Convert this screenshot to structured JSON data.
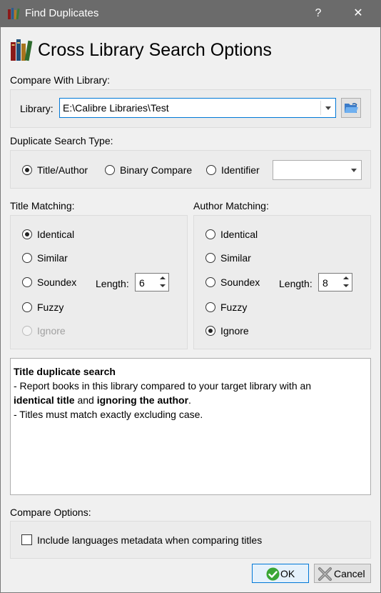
{
  "window": {
    "title": "Find Duplicates",
    "help_label": "?",
    "close_label": "✕"
  },
  "header": {
    "title": "Cross Library Search Options"
  },
  "compare_with": {
    "section_label": "Compare With Library:",
    "library_label": "Library:",
    "library_value": "E:\\Calibre Libraries\\Test"
  },
  "search_type": {
    "section_label": "Duplicate Search Type:",
    "options": [
      "Title/Author",
      "Binary Compare",
      "Identifier"
    ],
    "selected": "Title/Author",
    "identifier_value": ""
  },
  "title_matching": {
    "section_label": "Title Matching:",
    "options": [
      "Identical",
      "Similar",
      "Soundex",
      "Fuzzy",
      "Ignore"
    ],
    "selected": "Identical",
    "length_label": "Length:",
    "length_value": "6"
  },
  "author_matching": {
    "section_label": "Author Matching:",
    "options": [
      "Identical",
      "Similar",
      "Soundex",
      "Fuzzy",
      "Ignore"
    ],
    "selected": "Ignore",
    "length_label": "Length:",
    "length_value": "8"
  },
  "description": {
    "heading": "Title duplicate search",
    "line1_a": "- Report books in this library compared to your target library with an",
    "line2_bold1": "identical title",
    "line2_mid": " and ",
    "line2_bold2": "ignoring the author",
    "line2_end": ".",
    "line3": "- Titles must match exactly excluding case."
  },
  "compare_options": {
    "section_label": "Compare Options:",
    "include_languages_label": "Include languages metadata when comparing titles",
    "include_languages_checked": false
  },
  "buttons": {
    "ok_label": "OK",
    "cancel_label": "Cancel"
  },
  "colors": {
    "titlebar": "#6b6b6b",
    "accent": "#0078d7",
    "ok_check": "#3aa634",
    "cancel_x": "#7a7a7a"
  }
}
